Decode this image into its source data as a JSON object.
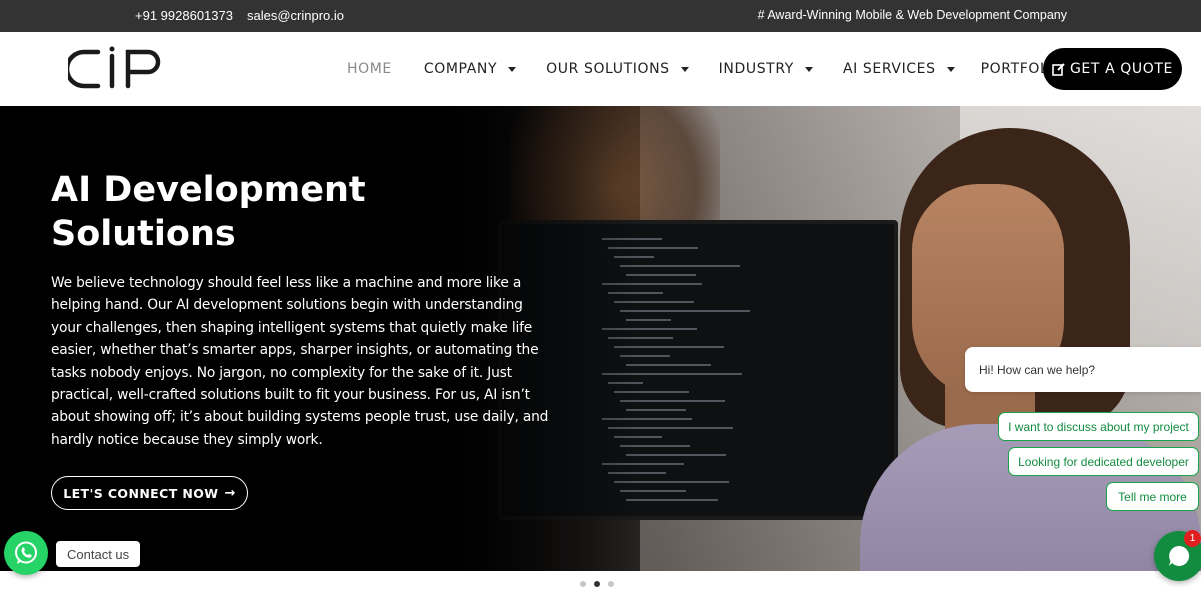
{
  "topbar": {
    "phone": "+91 9928601373",
    "email": "sales@crinpro.io",
    "tagline": "# Award-Winning Mobile & Web Development Company"
  },
  "brand": {
    "logo_text": "CiP",
    "logo_icon": "cip-logo"
  },
  "nav": {
    "items": [
      {
        "label": "HOME",
        "active": true,
        "dropdown": false
      },
      {
        "label": "COMPANY",
        "active": false,
        "dropdown": true
      },
      {
        "label": "OUR SOLUTIONS",
        "active": false,
        "dropdown": true
      },
      {
        "label": "INDUSTRY",
        "active": false,
        "dropdown": true
      },
      {
        "label": "AI SERVICES",
        "active": false,
        "dropdown": true
      },
      {
        "label": "PORTFOLIO",
        "active": false,
        "dropdown": false
      }
    ],
    "cta": "GET A QUOTE",
    "cta_icon": "edit-icon"
  },
  "hero": {
    "title": "AI Development Solutions",
    "body": "We believe technology should feel less like a machine and more like a helping hand. Our AI development solutions begin with understanding your challenges, then shaping intelligent systems that quietly make life easier, whether that’s smarter apps, sharper insights, or automating the tasks nobody enjoys. No jargon, no complexity for the sake of it. Just practical, well-crafted solutions built to fit your business. For us, AI isn’t about showing off; it’s about building systems people trust, use daily, and hardly notice because they simply work.",
    "button": "LET'S CONNECT NOW",
    "button_arrow": "→"
  },
  "whatsapp": {
    "label": "Contact us",
    "icon": "whatsapp-icon"
  },
  "chat": {
    "greeting": "Hi! How can we help?",
    "options": [
      "I want to discuss about my project",
      "Looking for dedicated developer",
      "Tell me more"
    ],
    "badge": "1",
    "icon": "chat-bubble-icon"
  },
  "carousel": {
    "slides": 3,
    "active": 2
  },
  "colors": {
    "topbar": "#333333",
    "cta": "#000000",
    "whatsapp": "#25d366",
    "chat_green": "#128c3e",
    "badge": "#e02020"
  }
}
